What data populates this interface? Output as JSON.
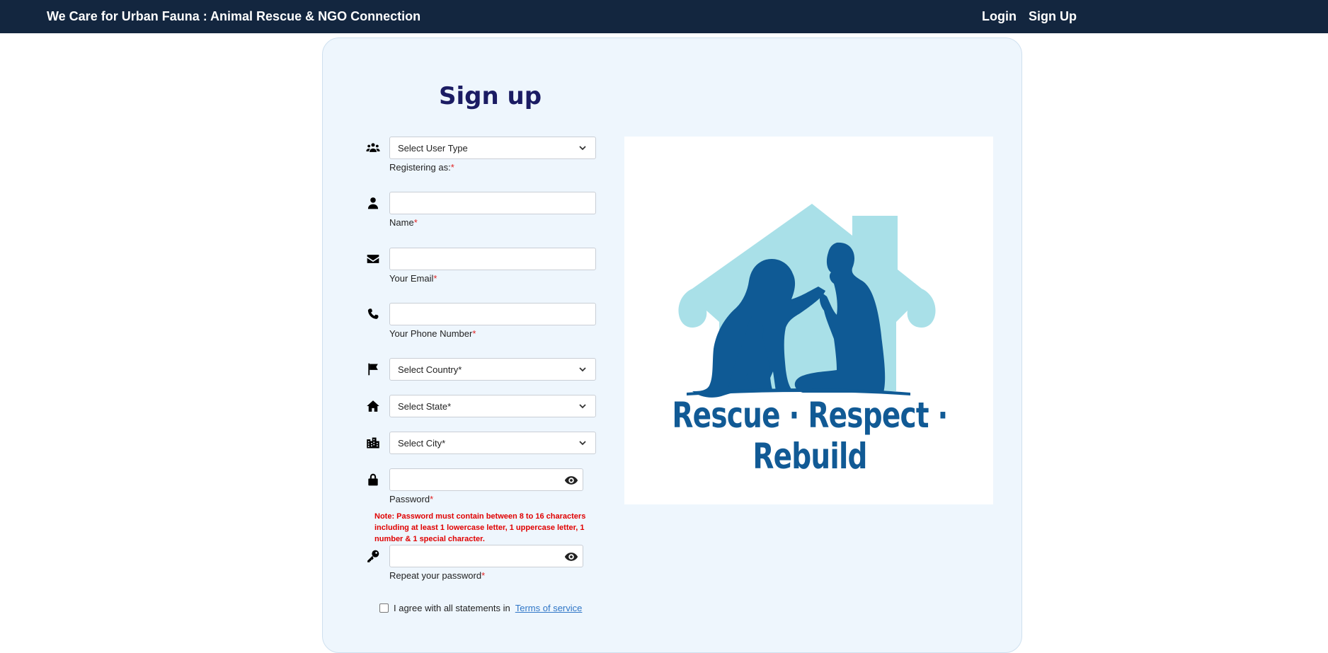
{
  "app": {
    "title": "We Care for Urban Fauna : Animal Rescue & NGO Connection",
    "nav": {
      "login": "Login",
      "signup": "Sign Up"
    }
  },
  "form": {
    "heading": "Sign up",
    "user_type": {
      "placeholder": "Select User Type",
      "label": "Registering as:",
      "required": "*"
    },
    "name": {
      "value": "",
      "label": "Name",
      "required": "*"
    },
    "email": {
      "value": "",
      "label": "Your Email",
      "required": "*"
    },
    "phone": {
      "value": "",
      "label": "Your Phone Number",
      "required": "*"
    },
    "country": {
      "placeholder": "Select Country*"
    },
    "state": {
      "placeholder": "Select State*"
    },
    "city": {
      "placeholder": "Select City*"
    },
    "password": {
      "value": "",
      "label": "Password",
      "required": "*"
    },
    "password_note": "Note: Password must contain between 8 to 16 characters including at least 1 lowercase letter, 1 uppercase letter, 1 number & 1 special character.",
    "repeat_password": {
      "value": "",
      "label": "Repeat your password",
      "required": "*"
    },
    "agree": {
      "text": "I agree with all statements in",
      "link": "Terms of service",
      "checked": false
    }
  },
  "logo": {
    "tagline": "Rescue · Respect · Rebuild",
    "colors": {
      "house": "#a9e0e8",
      "silhouette": "#0f5a95"
    }
  },
  "colors": {
    "navbar": "#13263f",
    "card": "#eef6fd",
    "heading": "#1b1c63",
    "required": "#e02424",
    "note": "#e00000",
    "link": "#2f76c7"
  }
}
